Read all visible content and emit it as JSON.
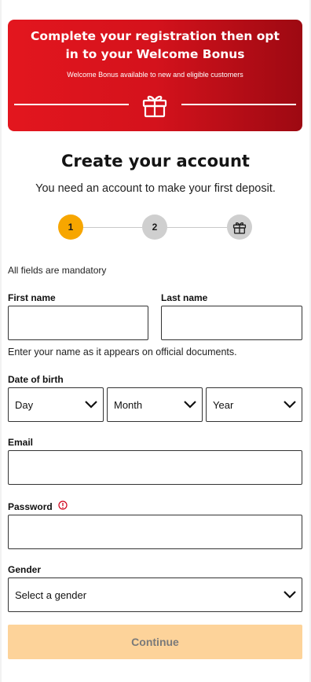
{
  "banner": {
    "title": "Complete your registration then opt in to your Welcome Bonus",
    "subtitle": "Welcome Bonus available to new and eligible customers",
    "icon": "gift-icon",
    "gradient_start": "#e3161e",
    "gradient_end": "#9d0912"
  },
  "header": {
    "title": "Create your account",
    "subtitle": "You need an account to make your first deposit."
  },
  "stepper": {
    "steps": [
      {
        "label": "1",
        "state": "active",
        "color": "#f7a600"
      },
      {
        "label": "2",
        "state": "inactive",
        "color": "#cfcfcf"
      },
      {
        "label": "",
        "state": "inactive",
        "icon": "gift-icon",
        "color": "#cfcfcf"
      }
    ]
  },
  "form": {
    "mandatory_note": "All fields are mandatory",
    "first_name": {
      "label": "First name",
      "value": ""
    },
    "last_name": {
      "label": "Last name",
      "value": ""
    },
    "name_hint": "Enter your name as it appears on official documents.",
    "dob": {
      "label": "Date of birth",
      "day": "Day",
      "month": "Month",
      "year": "Year"
    },
    "email": {
      "label": "Email",
      "value": ""
    },
    "password": {
      "label": "Password",
      "value": "",
      "info_icon": "info-icon",
      "info_color": "#d0021b"
    },
    "gender": {
      "label": "Gender",
      "selected": "Select a gender"
    },
    "continue_label": "Continue",
    "continue_color": "#fdd39a"
  }
}
